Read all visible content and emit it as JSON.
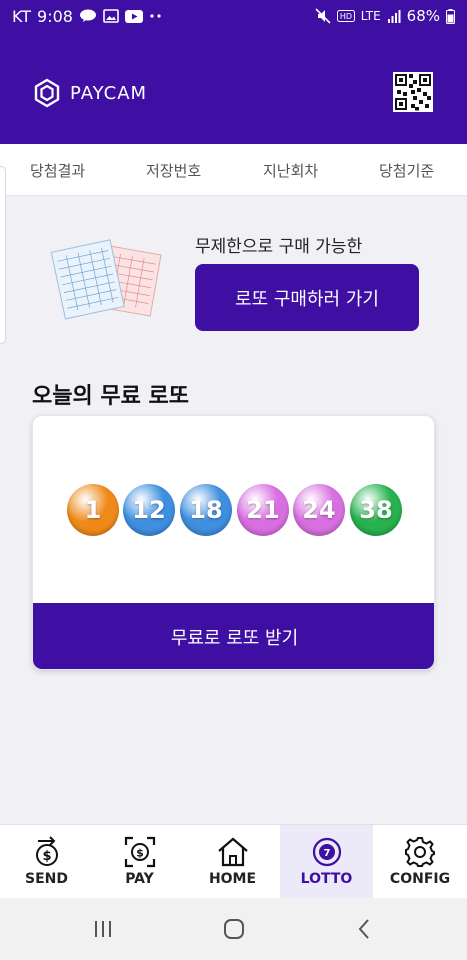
{
  "status_bar": {
    "carrier": "KT",
    "time": "9:08",
    "network": "LTE",
    "battery": "68%"
  },
  "header": {
    "logo_text": "PAYCAM"
  },
  "tabs": [
    {
      "label": "당첨결과"
    },
    {
      "label": "저장번호"
    },
    {
      "label": "지난회차"
    },
    {
      "label": "당첨기준"
    }
  ],
  "promo": {
    "text": "무제한으로 구매 가능한",
    "button_label": "로또 구매하러 가기"
  },
  "free_lotto": {
    "title": "오늘의 무료 로또",
    "numbers": [
      "1",
      "12",
      "18",
      "21",
      "24",
      "38"
    ],
    "button_label": "무료로 로또 받기"
  },
  "ball_colors": [
    "#ef8a1a",
    "#3e8fe0",
    "#3e8fe0",
    "#d86fe0",
    "#d86fe0",
    "#27b24f"
  ],
  "bottom_nav": [
    {
      "label": "SEND",
      "icon": "send-money-icon"
    },
    {
      "label": "PAY",
      "icon": "pay-scan-icon"
    },
    {
      "label": "HOME",
      "icon": "home-icon"
    },
    {
      "label": "LOTTO",
      "icon": "lotto-ball-icon",
      "active": true
    },
    {
      "label": "CONFIG",
      "icon": "gear-icon"
    }
  ],
  "colors": {
    "brand": "#3f0fa4",
    "active_tab_bg": "#ece9f8"
  }
}
